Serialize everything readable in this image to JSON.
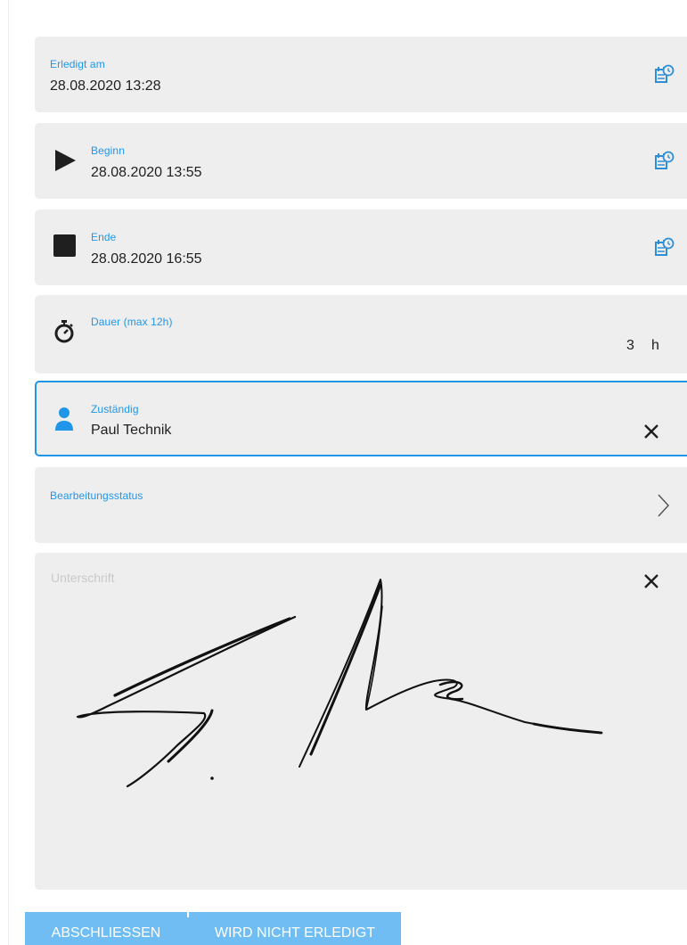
{
  "fields": {
    "erledigt": {
      "label": "Erledigt am",
      "value": "28.08.2020 13:28",
      "icon": "calendar-clock-icon"
    },
    "beginn": {
      "label": "Beginn",
      "value": "28.08.2020 13:55",
      "icon": "play-icon"
    },
    "ende": {
      "label": "Ende",
      "value": "28.08.2020 16:55",
      "icon": "stop-icon"
    },
    "dauer": {
      "label": "Dauer (max 12h)",
      "value": "3",
      "unit": "h",
      "icon": "stopwatch-icon"
    },
    "zustaendig": {
      "label": "Zuständig",
      "value": "Paul Technik",
      "icon": "person-icon"
    },
    "status": {
      "label": "Bearbeitungsstatus",
      "value": ""
    }
  },
  "signature": {
    "placeholder": "Unterschrift"
  },
  "buttons": {
    "abschliessen": "ABSCHLIESSEN",
    "nicht_erledigt": "WIRD NICHT ERLEDIGT"
  },
  "colors": {
    "accent": "#2196e8",
    "card_bg": "#eeeeee",
    "button_bg": "#6fbdf2"
  }
}
